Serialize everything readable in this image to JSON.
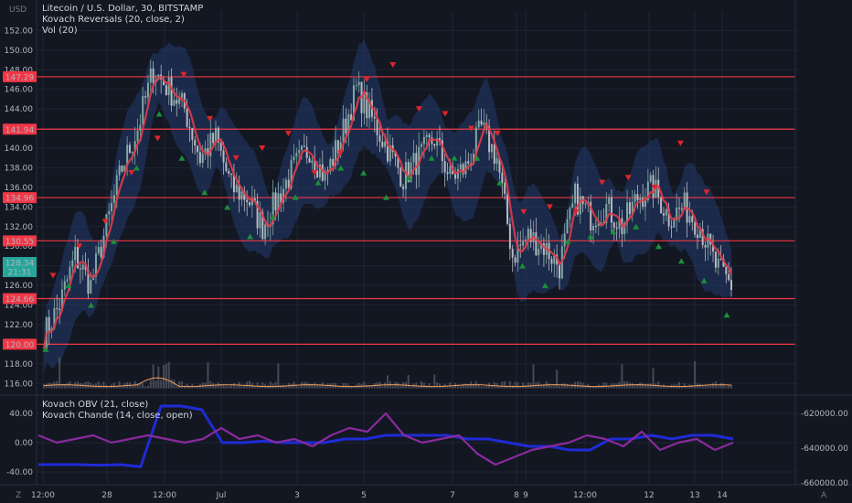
{
  "legend_main": {
    "symbol": "Litecoin / U.S. Dollar, 30, BITSTAMP",
    "indicator1": "Kovach Reversals (20, close, 2)",
    "indicator2": "Vol (20)"
  },
  "legend_lower": {
    "indicator1": "Kovach OBV (21, close)",
    "indicator2": "Kovach Chande (14, close, open)"
  },
  "axis_currency": "USD",
  "corner_left": "Z",
  "corner_right": "A",
  "colors": {
    "background": "#131722",
    "grid": "#1f2433",
    "support_line": "#f23645",
    "candle_up": "#7fa9a4",
    "candle_down": "#b8b8c0",
    "band": "#233a6b",
    "ma": "#e03c48",
    "buy_marker": "#1b8f3a",
    "sell_marker": "#e0252b",
    "volume": "#5d606b",
    "volume_ma": "#f0a060",
    "obv": "#1f2bd6",
    "chande": "#8a2a9c",
    "last_price_label": "#26a69a"
  },
  "chart_data": [
    {
      "type": "candlestick",
      "name": "price",
      "y_ticks": [
        116,
        118,
        120,
        122,
        124,
        126,
        128,
        130,
        132,
        134,
        136,
        138,
        140,
        142,
        144,
        146,
        148,
        150,
        152
      ],
      "y_tick_labels": [
        "116.00",
        "118.00",
        "120.00",
        "122.00",
        "124.00",
        "126.00",
        "128.00",
        "130.00",
        "132.00",
        "134.00",
        "136.00",
        "138.00",
        "140.00",
        "142.00",
        "144.00",
        "146.00",
        "148.00",
        "150.00",
        "152.00"
      ],
      "ylim": [
        115,
        154
      ],
      "x_tick_labels": [
        "12:00",
        "28",
        "12:00",
        "Jul",
        "3",
        "5",
        "7",
        "8",
        "9",
        "12:00",
        "12",
        "13",
        "14"
      ],
      "horizontal_lines": [
        {
          "value": 147.29,
          "label": "147.29"
        },
        {
          "value": 141.94,
          "label": "141.94"
        },
        {
          "value": 134.96,
          "label": "134.96"
        },
        {
          "value": 130.55,
          "label": "130.55"
        },
        {
          "value": 124.66,
          "label": "124.66"
        },
        {
          "value": 120.0,
          "label": "120.00"
        }
      ],
      "last_price": {
        "value": 128.34,
        "label": "128.34",
        "countdown": "21:31"
      },
      "price_path": [
        [
          0,
          121
        ],
        [
          6,
          124
        ],
        [
          12,
          129
        ],
        [
          18,
          126
        ],
        [
          24,
          132
        ],
        [
          30,
          138
        ],
        [
          36,
          142
        ],
        [
          42,
          148
        ],
        [
          48,
          146
        ],
        [
          54,
          144
        ],
        [
          60,
          139
        ],
        [
          66,
          141
        ],
        [
          72,
          136
        ],
        [
          78,
          135
        ],
        [
          84,
          132
        ],
        [
          90,
          135
        ],
        [
          96,
          138
        ],
        [
          102,
          140
        ],
        [
          108,
          137
        ],
        [
          114,
          141
        ],
        [
          120,
          146
        ],
        [
          126,
          143
        ],
        [
          132,
          140
        ],
        [
          138,
          137
        ],
        [
          144,
          139
        ],
        [
          150,
          141
        ],
        [
          156,
          137
        ],
        [
          162,
          138
        ],
        [
          168,
          142
        ],
        [
          174,
          139
        ],
        [
          180,
          129
        ],
        [
          186,
          131
        ],
        [
          192,
          130
        ],
        [
          198,
          128
        ],
        [
          204,
          135
        ],
        [
          210,
          133
        ],
        [
          216,
          134
        ],
        [
          222,
          132
        ],
        [
          228,
          135
        ],
        [
          234,
          136
        ],
        [
          240,
          133
        ],
        [
          246,
          134
        ],
        [
          252,
          132
        ],
        [
          258,
          128
        ],
        [
          264,
          126
        ]
      ],
      "buy_markers_value": [
        119.5,
        126,
        124,
        130.5,
        138,
        143.5,
        139,
        135.5,
        134,
        131,
        133,
        135,
        136.5,
        138,
        137.5,
        135,
        137,
        139,
        139,
        139,
        136.5,
        128,
        126,
        130.5,
        131,
        131.5,
        132,
        130,
        128.5,
        126.5,
        123
      ],
      "sell_markers_value": [
        127,
        130,
        132.5,
        137.5,
        141,
        147.5,
        143,
        139,
        140,
        141.5,
        137.5,
        139.5,
        147,
        148.5,
        144,
        143.5,
        142,
        141.5,
        133.5,
        134,
        133.5,
        136.5,
        137,
        136,
        140.5,
        135.5
      ],
      "volume_baseline": 115.5
    },
    {
      "type": "line",
      "name": "oscillators",
      "y_ticks": [
        -40,
        0,
        40
      ],
      "y_tick_labels_left": [
        "-40.00",
        "0.00",
        "40.00"
      ],
      "ylim_left": [
        -55,
        55
      ],
      "y_tick_labels_right": [
        "-620000.00",
        "-640000.00",
        "-660000.00"
      ],
      "series": [
        {
          "name": "Kovach OBV (21, close)",
          "values": [
            -30,
            -30,
            -30,
            -31,
            -30,
            -33,
            50,
            50,
            45,
            0,
            0,
            2,
            0,
            0,
            0,
            5,
            5,
            10,
            10,
            10,
            10,
            5,
            5,
            0,
            -5,
            -5,
            -10,
            -10,
            5,
            5,
            10,
            5,
            10,
            10,
            5
          ]
        },
        {
          "name": "Kovach Chande (14, close, open)",
          "values": [
            10,
            0,
            5,
            10,
            0,
            5,
            10,
            5,
            0,
            5,
            20,
            5,
            10,
            0,
            5,
            -5,
            10,
            20,
            15,
            40,
            10,
            0,
            5,
            10,
            -15,
            -30,
            -20,
            -10,
            -5,
            0,
            10,
            5,
            -5,
            15,
            -10,
            0,
            5,
            -10,
            0
          ]
        }
      ]
    }
  ]
}
